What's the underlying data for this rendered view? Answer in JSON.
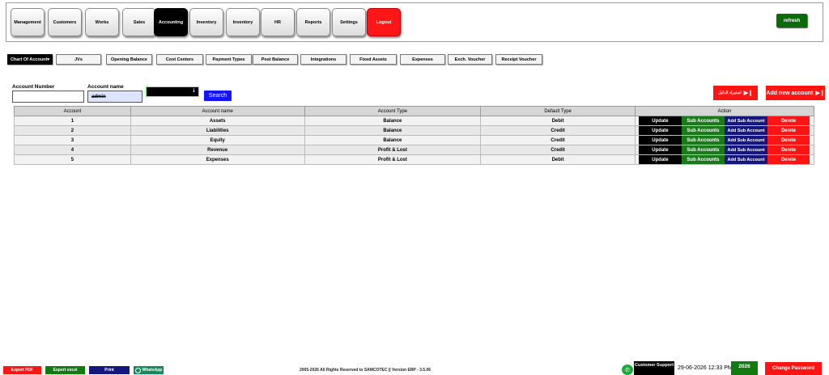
{
  "nav": {
    "items": [
      "Management",
      "Customers",
      "Works",
      "Sales",
      "Accounting",
      "Inventory",
      "Inventory",
      "HR",
      "Reports",
      "Settings",
      "Logout"
    ],
    "active": "Accounting",
    "refresh_label": "refresh"
  },
  "tabs": {
    "items": [
      "Chart Of Account",
      "JVs",
      "Opening Balance",
      "Cost Centers",
      "Payment Types",
      "Post Balance",
      "Integrations",
      "Fixed Assets",
      "Expenses",
      "Exch. Voucher",
      "Receipt Voucher"
    ],
    "active": "Chart Of Account"
  },
  "search": {
    "account_number_label": "Account Number",
    "account_number_value": "",
    "account_name_label": "Account name",
    "account_name_value": "admin",
    "select_value": "",
    "button_label": "Search"
  },
  "actions": {
    "arabic_button_label": "استيراد الدليل",
    "add_account_label": "Add new account"
  },
  "table": {
    "headers": [
      "Account",
      "Account name",
      "Account Type",
      "Default Type",
      "Action"
    ],
    "rows": [
      {
        "account": "1",
        "name": "Assets",
        "type": "Balance",
        "default": "Debit"
      },
      {
        "account": "2",
        "name": "Liabilities",
        "type": "Balance",
        "default": "Credit"
      },
      {
        "account": "3",
        "name": "Equity",
        "type": "Balance",
        "default": "Credit"
      },
      {
        "account": "4",
        "name": "Revenue",
        "type": "Profit & Lost",
        "default": "Credit"
      },
      {
        "account": "5",
        "name": "Expenses",
        "type": "Profit & Lost",
        "default": "Debit"
      }
    ],
    "row_actions": {
      "update": "Update",
      "sub_accounts": "Sub Accounts",
      "add_sub": "Add Sub Account",
      "delete": "Delete"
    }
  },
  "footer": {
    "export_pdf": "Export PDF",
    "export_excel": "Export excel",
    "print": "Print",
    "whatsapp": "WhatsApp",
    "copyright": "2005-2026 All Rights Reserved to SAMCOTEC || Version ERP - 3.5.06",
    "support_label": "Customer Support",
    "datetime": "29-06-2026 12:33 PM",
    "year": "2026",
    "change_password": "Change Password"
  },
  "colors": {
    "accent_red": "#ff1414",
    "accent_green": "#117a11",
    "accent_blue": "#1414ff",
    "accent_navy": "#161680"
  }
}
